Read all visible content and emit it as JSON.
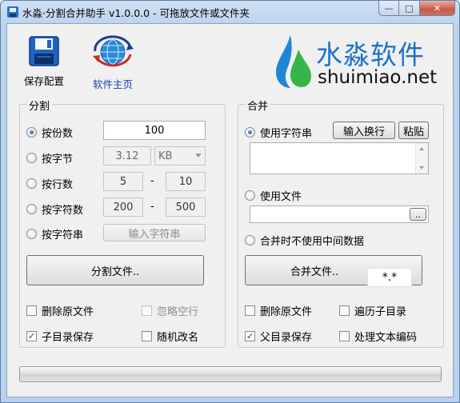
{
  "window": {
    "title": "水淼·分割合并助手 v1.0.0.0 - 可拖放文件或文件夹",
    "min_glyph": "—",
    "max_glyph": "□",
    "close_glyph": "✕"
  },
  "toolbar": {
    "save_config": "保存配置",
    "homepage": "软件主页"
  },
  "logo": {
    "name": "水淼软件",
    "url": "shuimiao.net"
  },
  "split": {
    "title": "分割",
    "by_parts": {
      "label": "按份数",
      "value": "100",
      "selected": true
    },
    "by_bytes": {
      "label": "按字节",
      "value": "3.12",
      "unit": "KB"
    },
    "by_lines": {
      "label": "按行数",
      "from": "5",
      "to": "10"
    },
    "by_chars": {
      "label": "按字符数",
      "from": "200",
      "to": "500"
    },
    "by_string": {
      "label": "按字符串",
      "button": "输入字符串"
    },
    "range_sep": "-",
    "split_button": "分割文件..",
    "delete_source": {
      "label": "删除原文件",
      "checked": false
    },
    "ignore_blank": {
      "label": "忽略空行",
      "checked": false,
      "disabled": true
    },
    "subdir_save": {
      "label": "子目录保存",
      "checked": true
    },
    "random_rename": {
      "label": "随机改名",
      "checked": false
    }
  },
  "merge": {
    "title": "合并",
    "use_string": {
      "label": "使用字符串",
      "selected": true
    },
    "newline_button": "输入换行",
    "paste_button": "粘贴",
    "use_file": {
      "label": "使用文件",
      "selected": false
    },
    "browse_button": "..",
    "no_temp": {
      "label": "合并时不使用中间数据",
      "selected": false
    },
    "merge_button": "合并文件..",
    "ext_value": "*.*",
    "delete_source": {
      "label": "删除原文件",
      "checked": false
    },
    "walk_subdirs": {
      "label": "遍历子目录",
      "checked": false
    },
    "parent_save": {
      "label": "父目录保存",
      "checked": true
    },
    "text_encoding": {
      "label": "处理文本编码",
      "checked": false
    }
  },
  "check_glyph": "✓",
  "progress": {
    "value": 0
  }
}
